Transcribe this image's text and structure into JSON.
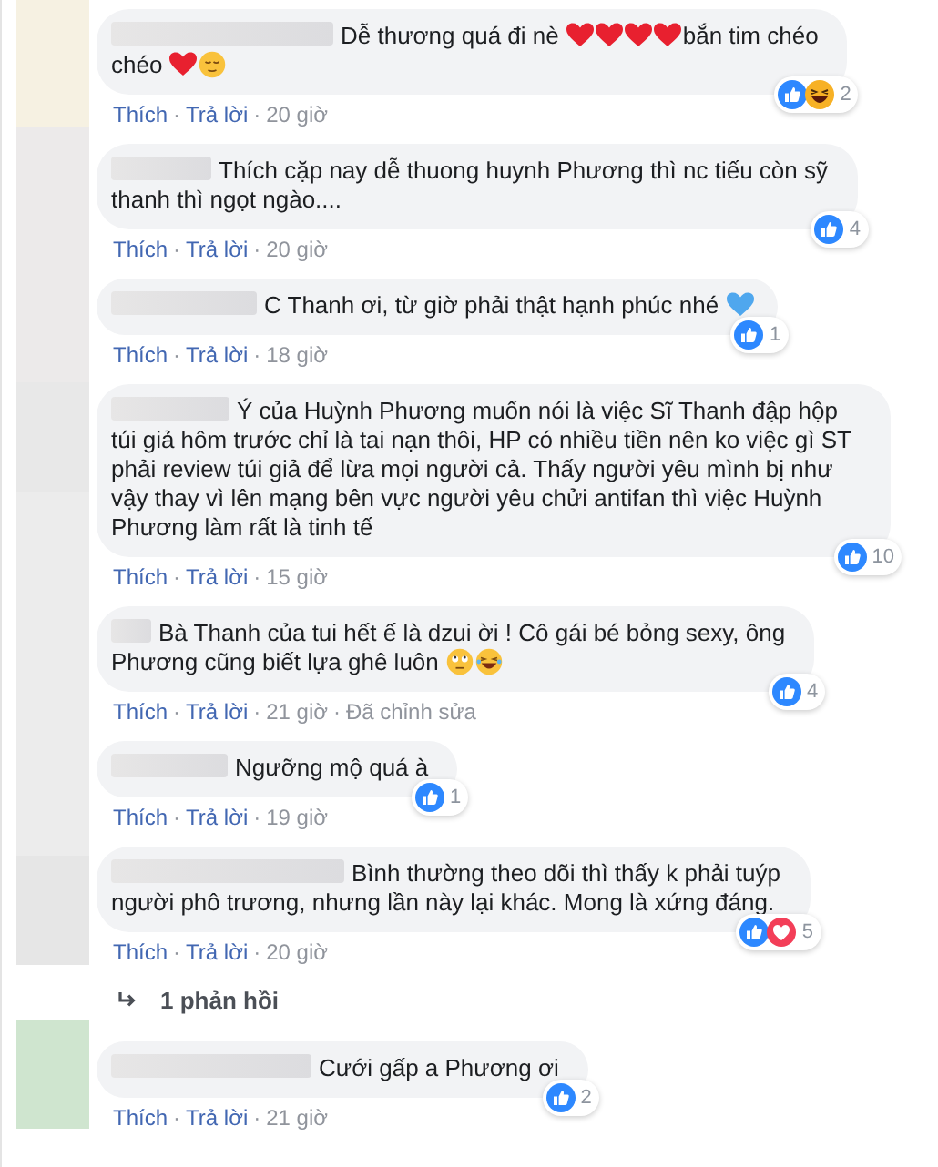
{
  "separator": "·",
  "comments": [
    {
      "body": [
        {
          "kind": "text",
          "text": "Dễ thương quá đi nè"
        },
        {
          "kind": "heart"
        },
        {
          "kind": "heart"
        },
        {
          "kind": "heart"
        },
        {
          "kind": "heart"
        },
        {
          "kind": "text",
          "text": "bắn tim chéo"
        },
        {
          "kind": "br"
        },
        {
          "kind": "text",
          "text": "chéo"
        },
        {
          "kind": "heart"
        },
        {
          "kind": "relieved"
        }
      ],
      "reactions": [
        {
          "kind": "like"
        },
        {
          "kind": "haha"
        }
      ],
      "count": "2",
      "meta": [
        {
          "kind": "link",
          "text": "Thích"
        },
        {
          "kind": "link",
          "text": "Trả lời"
        },
        {
          "kind": "time",
          "text": "20 giờ"
        }
      ]
    },
    {
      "body": [
        {
          "kind": "text",
          "text": "Thích cặp nay dễ thuong huynh Phương thì nc tiếu còn sỹ"
        },
        {
          "kind": "br"
        },
        {
          "kind": "text",
          "text": "thanh thì ngọt ngào...."
        }
      ],
      "reactions": [
        {
          "kind": "like"
        }
      ],
      "count": "4",
      "meta": [
        {
          "kind": "link",
          "text": "Thích"
        },
        {
          "kind": "link",
          "text": "Trả lời"
        },
        {
          "kind": "time",
          "text": "20 giờ"
        }
      ]
    },
    {
      "body": [
        {
          "kind": "text",
          "text": "C Thanh ơi, từ giờ phải thật hạnh phúc nhé"
        },
        {
          "kind": "blueheart"
        }
      ],
      "reactions": [
        {
          "kind": "like"
        }
      ],
      "count": "1",
      "meta": [
        {
          "kind": "link",
          "text": "Thích"
        },
        {
          "kind": "link",
          "text": "Trả lời"
        },
        {
          "kind": "time",
          "text": "18 giờ"
        }
      ]
    },
    {
      "body": [
        {
          "kind": "text",
          "text": "Ý của Huỳnh Phương muốn nói là việc Sĩ Thanh đập hộp"
        },
        {
          "kind": "br"
        },
        {
          "kind": "text",
          "text": "túi giả hôm trước chỉ là tai nạn thôi, HP có nhiều tiền nên ko việc gì ST phải review túi giả để lừa mọi người cả. Thấy người yêu mình bị như vậy thay vì lên mạng bên vực người yêu chửi antifan thì việc Huỳnh Phương làm rất là tinh tế"
        }
      ],
      "reactions": [
        {
          "kind": "like"
        }
      ],
      "count": "10",
      "meta": [
        {
          "kind": "link",
          "text": "Thích"
        },
        {
          "kind": "link",
          "text": "Trả lời"
        },
        {
          "kind": "time",
          "text": "15 giờ"
        }
      ]
    },
    {
      "body": [
        {
          "kind": "text",
          "text": "Bà Thanh của tui hết ế là dzui ời ! Cô gái bé bỏng sexy, ông"
        },
        {
          "kind": "br"
        },
        {
          "kind": "text",
          "text": "Phương cũng biết lựa ghê luôn"
        },
        {
          "kind": "eyeroll"
        },
        {
          "kind": "laugh"
        }
      ],
      "reactions": [
        {
          "kind": "like"
        }
      ],
      "count": "4",
      "meta": [
        {
          "kind": "link",
          "text": "Thích"
        },
        {
          "kind": "link",
          "text": "Trả lời"
        },
        {
          "kind": "time",
          "text": "21 giờ"
        },
        {
          "kind": "time",
          "text": "Đã chỉnh sửa"
        }
      ]
    },
    {
      "body": [
        {
          "kind": "text",
          "text": "Ngưỡng mộ quá à"
        }
      ],
      "reactions": [
        {
          "kind": "like"
        }
      ],
      "count": "1",
      "meta": [
        {
          "kind": "link",
          "text": "Thích"
        },
        {
          "kind": "link",
          "text": "Trả lời"
        },
        {
          "kind": "time",
          "text": "19 giờ"
        }
      ]
    },
    {
      "body": [
        {
          "kind": "text",
          "text": "Bình thường theo dõi thì thấy k phải tuýp"
        },
        {
          "kind": "br"
        },
        {
          "kind": "text",
          "text": "người phô trương, nhưng lần này lại khác. Mong là xứng đáng."
        }
      ],
      "reactions": [
        {
          "kind": "like"
        },
        {
          "kind": "love"
        }
      ],
      "count": "5",
      "meta": [
        {
          "kind": "link",
          "text": "Thích"
        },
        {
          "kind": "link",
          "text": "Trả lời"
        },
        {
          "kind": "time",
          "text": "20 giờ"
        }
      ],
      "replies_link": "1 phản hồi"
    },
    {
      "body": [
        {
          "kind": "text",
          "text": "Cưới gấp a Phương ơi"
        }
      ],
      "reactions": [
        {
          "kind": "like"
        }
      ],
      "count": "2",
      "meta": [
        {
          "kind": "link",
          "text": "Thích"
        },
        {
          "kind": "link",
          "text": "Trả lời"
        },
        {
          "kind": "time",
          "text": "21 giờ"
        }
      ]
    }
  ]
}
